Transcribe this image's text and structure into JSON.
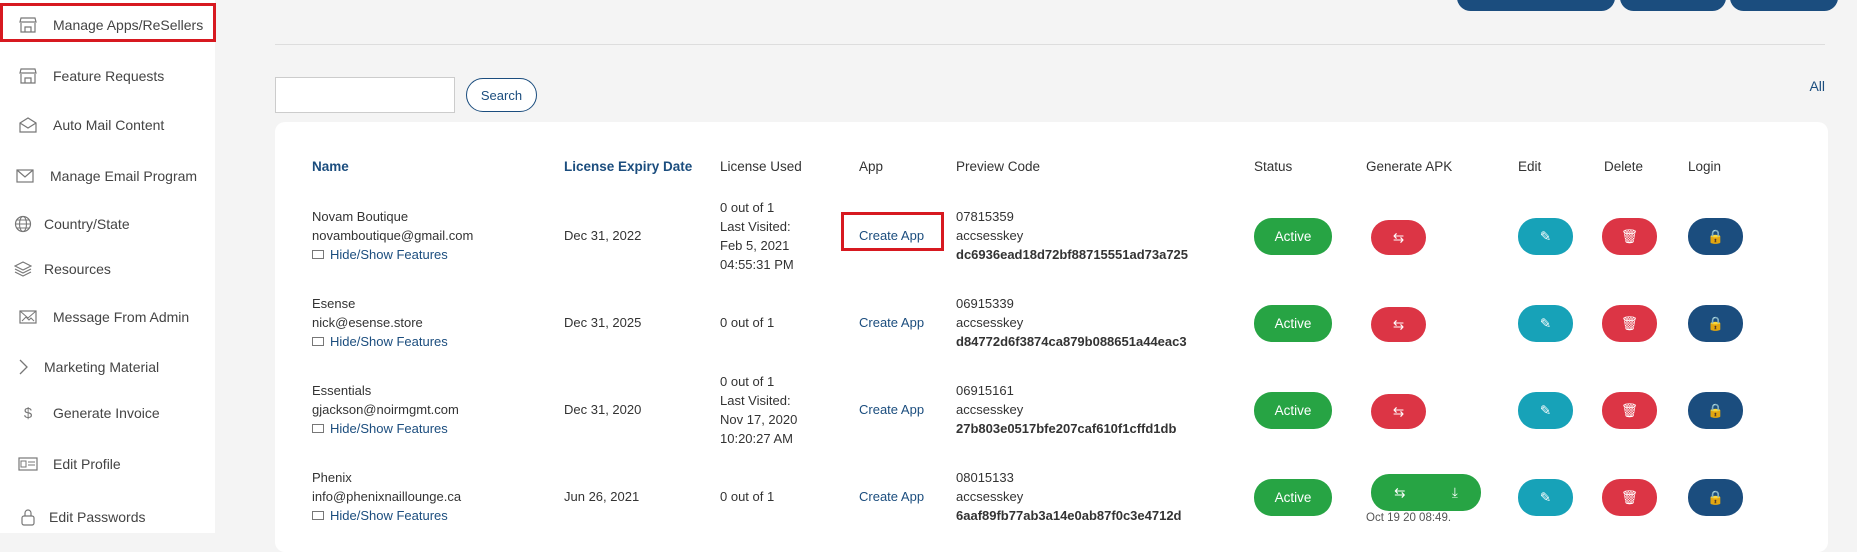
{
  "sidebar": {
    "items": [
      {
        "label": "Manage Apps/ReSellers",
        "icon": "store-icon"
      },
      {
        "label": "Feature Requests",
        "icon": "store-icon"
      },
      {
        "label": "Auto Mail Content",
        "icon": "mail-open-icon"
      },
      {
        "label": "Manage Email Program",
        "icon": "mail-icon"
      },
      {
        "label": "Country/State",
        "icon": "globe-icon"
      },
      {
        "label": "Resources",
        "icon": "layers-icon"
      },
      {
        "label": "Message From Admin",
        "icon": "mail-image-icon"
      },
      {
        "label": "Marketing Material",
        "icon": "chevron-right-icon"
      },
      {
        "label": "Generate Invoice",
        "icon": "dollar-icon"
      },
      {
        "label": "Edit Profile",
        "icon": "id-card-icon"
      },
      {
        "label": "Edit Passwords",
        "icon": "lock-icon"
      }
    ]
  },
  "toolbar": {
    "search_value": "",
    "search_label": "Search",
    "all_label": "All"
  },
  "table": {
    "headers": {
      "name": "Name",
      "expiry": "License Expiry Date",
      "used": "License Used",
      "app": "App",
      "preview": "Preview Code",
      "status": "Status",
      "generate": "Generate APK",
      "edit": "Edit",
      "delete": "Delete",
      "login": "Login"
    },
    "rows": [
      {
        "name": "Novam Boutique",
        "email": "novamboutique@gmail.com",
        "features": "Hide/Show Features",
        "expiry": "Dec 31, 2022",
        "used": [
          "0 out of 1",
          "Last Visited:",
          "Feb 5, 2021",
          "04:55:31 PM"
        ],
        "app": "Create App",
        "code": "07815359",
        "key_label": "accsesskey",
        "key": "dc6936ead18d72bf88715551ad73a725",
        "status": "Active"
      },
      {
        "name": "Esense",
        "email": "nick@esense.store",
        "features": "Hide/Show Features",
        "expiry": "Dec 31, 2025",
        "used": [
          "0 out of 1"
        ],
        "app": "Create App",
        "code": "06915339",
        "key_label": "accsesskey",
        "key": "d84772d6f3874ca879b088651a44eac3",
        "status": "Active"
      },
      {
        "name": "Essentials",
        "email": "gjackson@noirmgmt.com",
        "features": "Hide/Show Features",
        "expiry": "Dec 31, 2020",
        "used": [
          "0 out of 1",
          "Last Visited:",
          "Nov 17, 2020",
          "10:20:27 AM"
        ],
        "app": "Create App",
        "code": "06915161",
        "key_label": "accsesskey",
        "key": "27b803e0517bfe207caf610f1cffd1db",
        "status": "Active"
      },
      {
        "name": "Phenix",
        "email": "info@phenixnaillounge.ca",
        "features": "Hide/Show Features",
        "expiry": "Jun 26, 2021",
        "used": [
          "0 out of 1"
        ],
        "app": "Create App",
        "code": "08015133",
        "key_label": "accsesskey",
        "key": "6aaf89fb77ab3a14e0ab87f0c3e4712d",
        "status": "Active",
        "apk_timestamp": "Oct 19 20 08:49."
      }
    ]
  },
  "colors": {
    "primary": "#1b4d7e",
    "success": "#27a444",
    "danger": "#dc3545",
    "info": "#17a2b8",
    "highlight": "#d71920"
  }
}
